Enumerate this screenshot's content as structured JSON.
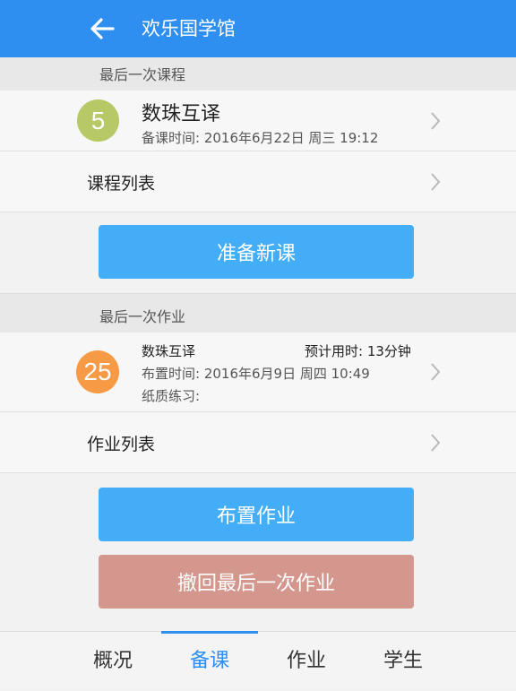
{
  "header": {
    "title": "欢乐国学馆",
    "back_icon": "arrow-left-icon"
  },
  "last_lesson": {
    "section_label": "最后一次课程",
    "badge": "5",
    "badge_color": "#b7c866",
    "title": "数珠互译",
    "prep_time": "备课时间: 2016年6月22日  周三  19:12"
  },
  "lesson_list": {
    "label": "课程列表"
  },
  "prepare_button": {
    "label": "准备新课",
    "color": "#43adf7"
  },
  "last_homework": {
    "section_label": "最后一次作业",
    "badge": "25",
    "badge_color": "#f79a45",
    "title": "数珠互译",
    "estimate": "预计用时: 13分钟",
    "assign_time": "布置时间: 2016年6月9日  周四  10:49",
    "paper_practice": "纸质练习:"
  },
  "homework_list": {
    "label": "作业列表"
  },
  "assign_button": {
    "label": "布置作业",
    "color": "#43adf7"
  },
  "recall_button": {
    "label": "撤回最后一次作业",
    "color": "#d3978e"
  },
  "tabs": [
    {
      "label": "概况"
    },
    {
      "label": "备课",
      "active": true
    },
    {
      "label": "作业"
    },
    {
      "label": "学生"
    }
  ],
  "accent_color": "#2e8ff0"
}
